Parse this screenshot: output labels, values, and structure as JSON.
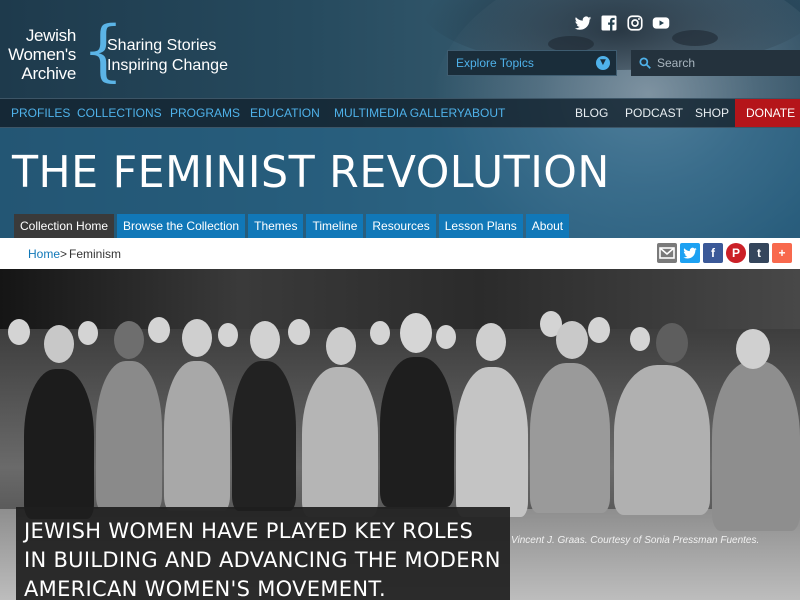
{
  "logo": {
    "name_line1": "Jewish",
    "name_line2": "Women's",
    "name_line3": "Archive",
    "tagline": "Sharing Stories\nInspiring Change",
    "brace_color": "#5bb4e6"
  },
  "social": [
    "twitter-icon",
    "facebook-icon",
    "instagram-icon",
    "youtube-icon"
  ],
  "explore": {
    "label": "Explore Topics"
  },
  "search": {
    "placeholder": "Search"
  },
  "nav": {
    "left": [
      "PROFILES",
      "COLLECTIONS",
      "PROGRAMS",
      "EDUCATION",
      "MULTIMEDIA GALLERY",
      "ABOUT"
    ],
    "right": [
      "BLOG",
      "PODCAST",
      "SHOP"
    ],
    "donate": "DONATE",
    "accent": "#4fb2ea",
    "donate_color": "#b5151a"
  },
  "page_title": "THE FEMINIST REVOLUTION",
  "tabs": [
    "Collection Home",
    "Browse the Collection",
    "Themes",
    "Timeline",
    "Resources",
    "Lesson Plans",
    "About"
  ],
  "breadcrumb": {
    "home": "Home",
    "separator": ">",
    "current": "Feminism"
  },
  "share": [
    "email-icon",
    "twitter-icon",
    "facebook-icon",
    "pinterest-icon",
    "tumblr-icon",
    "add-icon"
  ],
  "photo": {
    "caption": "Vincent J. Graas. Courtesy of Sonia Pressman Fuentes.",
    "statement": "JEWISH WOMEN HAVE PLAYED KEY ROLES IN BUILDING AND ADVANCING THE MODERN AMERICAN WOMEN'S MOVEMENT."
  }
}
